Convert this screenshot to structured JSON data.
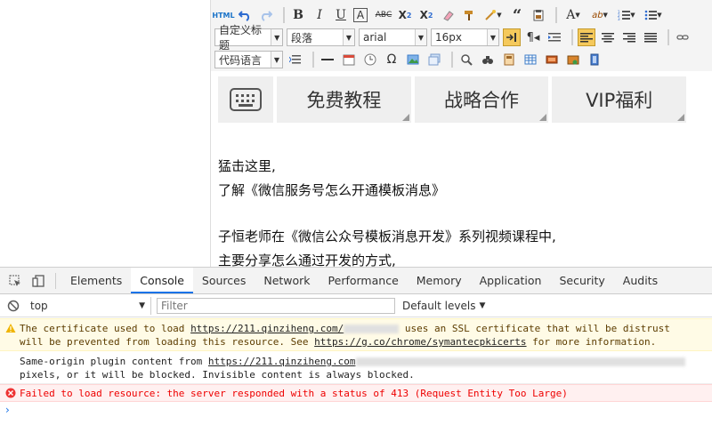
{
  "editor": {
    "row2": {
      "heading_select": "自定义标题",
      "paragraph_select": "段落",
      "font_select": "arial",
      "size_select": "16px"
    },
    "row3": {
      "code_lang_select": "代码语言"
    },
    "banner": {
      "items": [
        "免费教程",
        "战略合作",
        "VIP福利"
      ]
    },
    "paragraphs": [
      "猛击这里,",
      "了解《微信服务号怎么开通模板消息》",
      "子恒老师在《微信公众号模板消息开发》系列视频课程中,",
      "主要分享怎么通过开发的方式,"
    ]
  },
  "devtools": {
    "tabs": [
      "Elements",
      "Console",
      "Sources",
      "Network",
      "Performance",
      "Memory",
      "Application",
      "Security",
      "Audits"
    ],
    "active_tab": "Console",
    "context": "top",
    "filter_placeholder": "Filter",
    "levels": "Default levels",
    "messages": {
      "warning_line1_a": "The certificate used to load ",
      "warning_line1_link": "https://211.qinziheng.com/",
      "warning_line1_b": " uses an SSL certificate that will be distrust",
      "warning_line2_a": "will be prevented from loading this resource. See ",
      "warning_line2_link": "https://g.co/chrome/symantecpkicerts",
      "warning_line2_b": " for more information.",
      "info_line1_a": "Same-origin plugin content from ",
      "info_line1_link": "https://211.qinziheng.com",
      "info_line2": "pixels, or it will be blocked. Invisible content is always blocked.",
      "error_line": "Failed to load resource: the server responded with a status of 413 (Request Entity Too Large)"
    },
    "prompt_symbol": "›"
  },
  "colors": {
    "warning_bg": "#fffbe6",
    "error_text": "#e00000",
    "active_tab_underline": "#1a73e8"
  }
}
